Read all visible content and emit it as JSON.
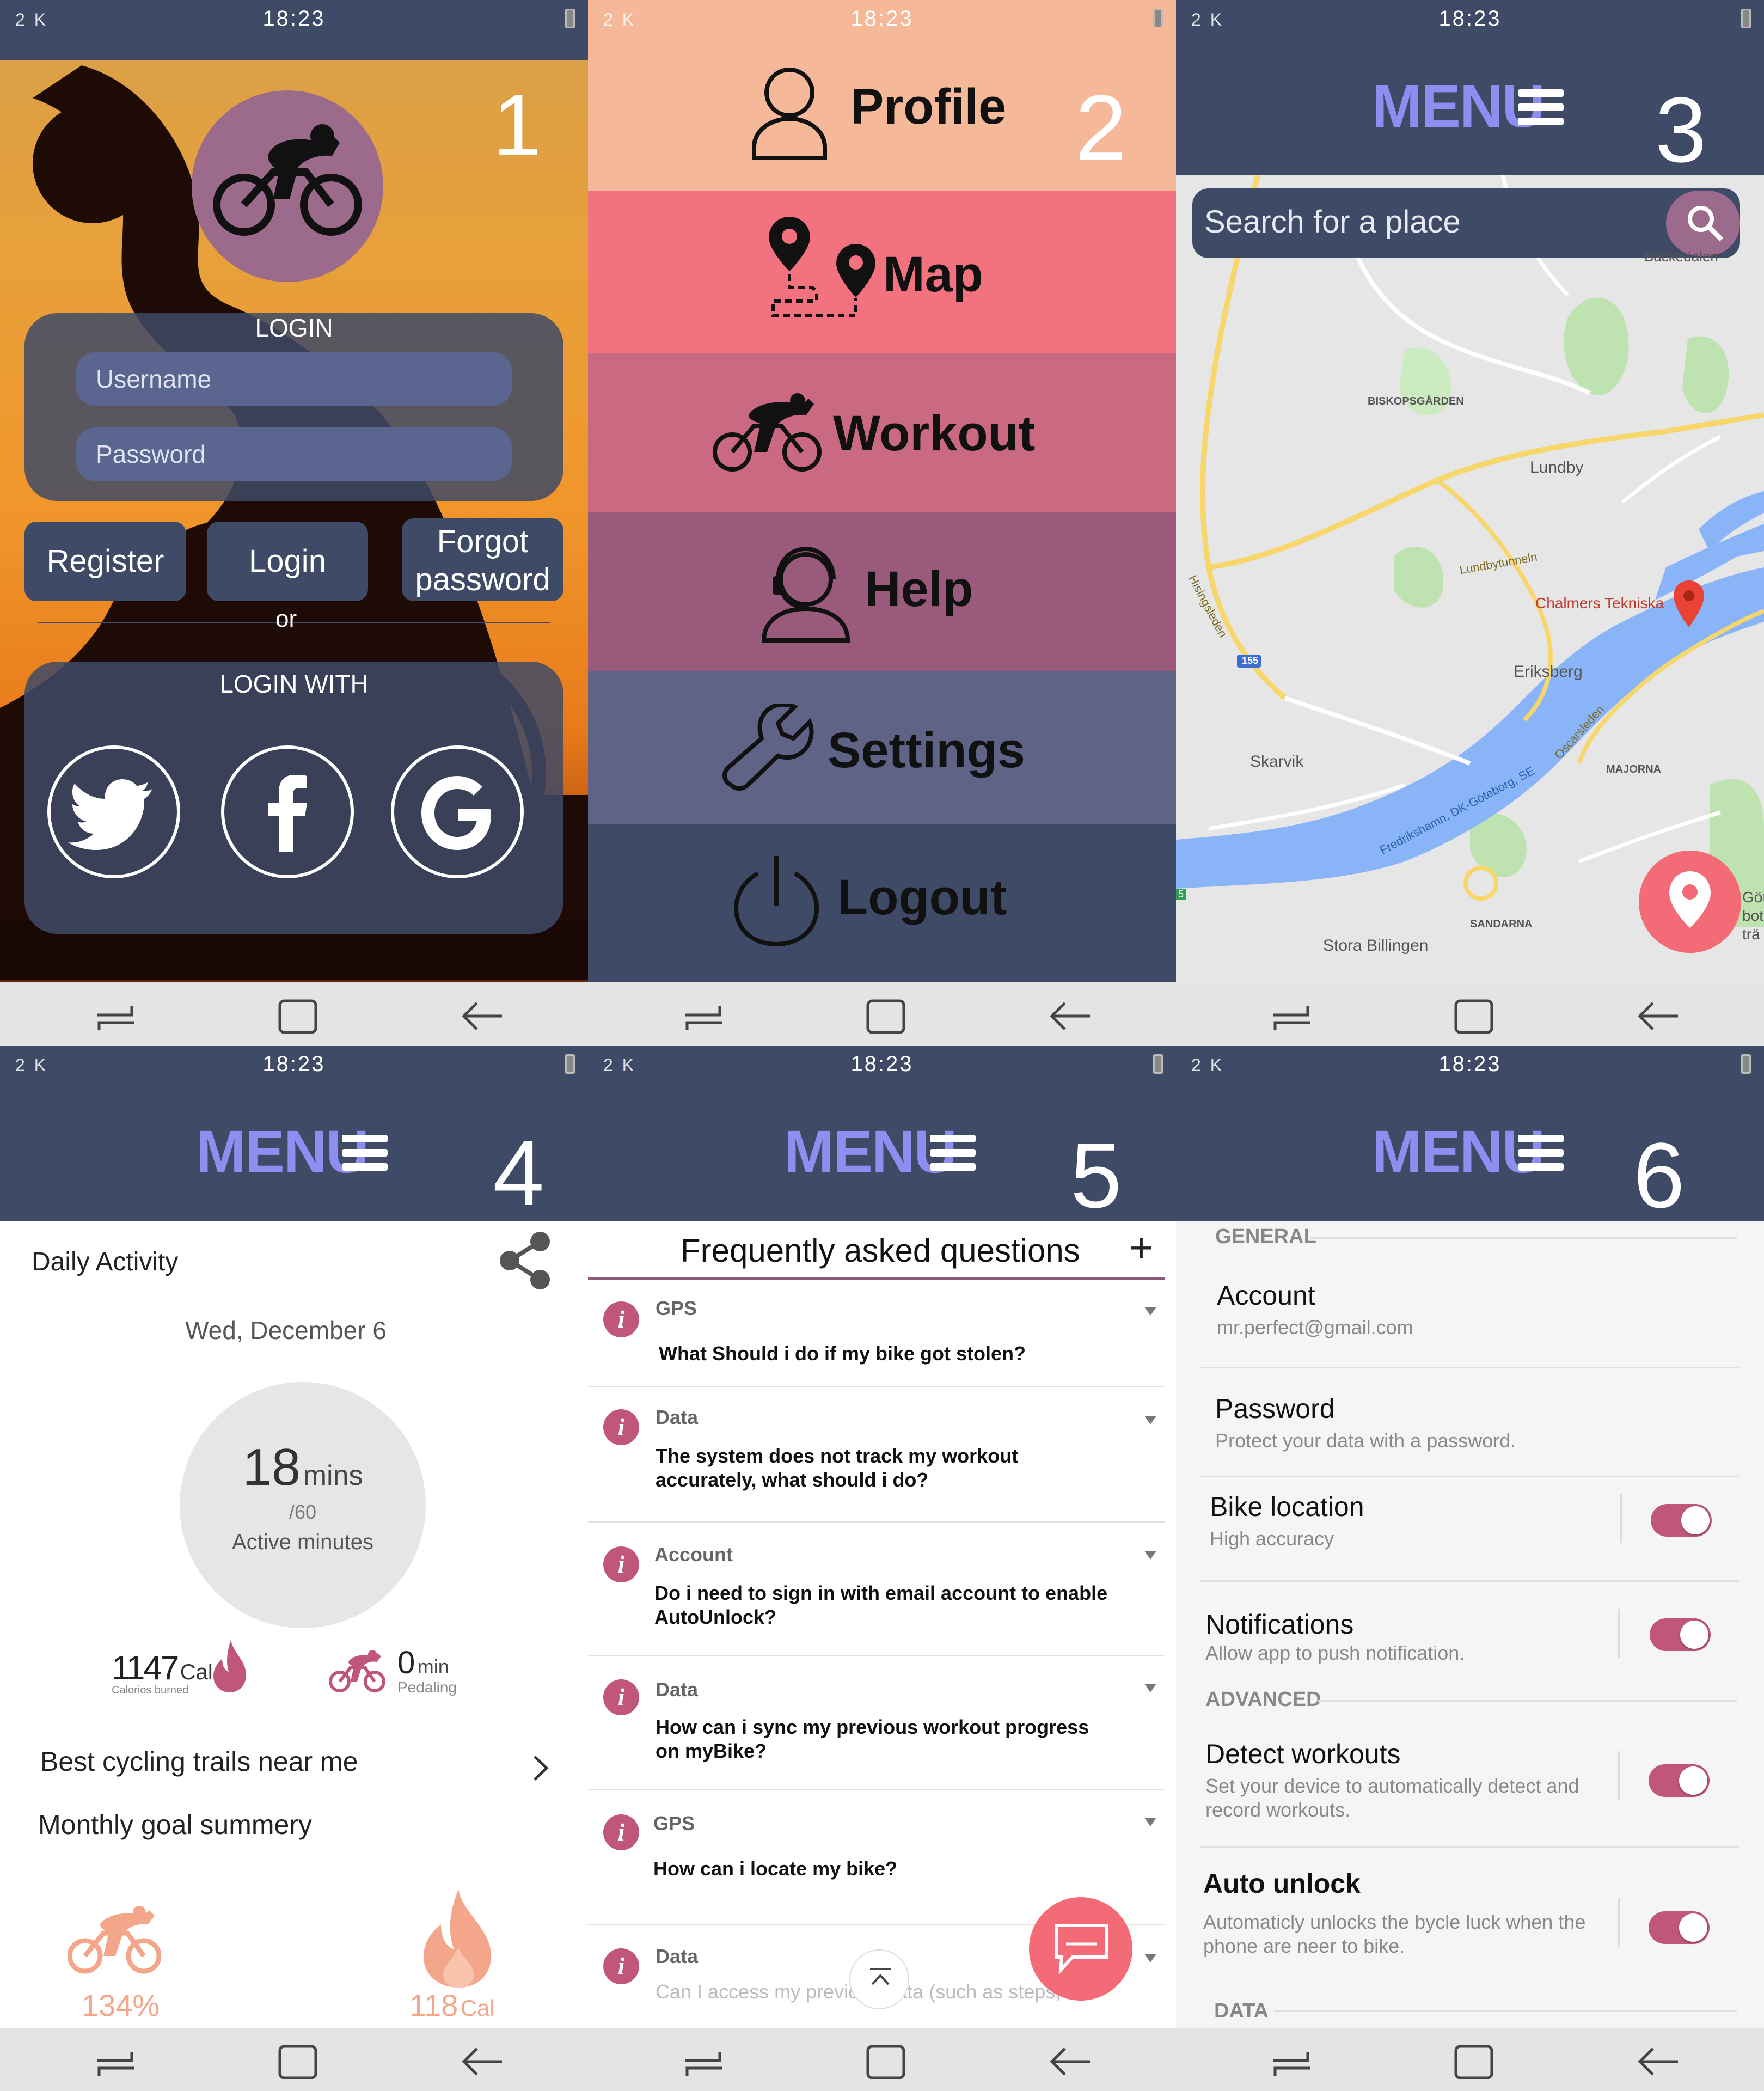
{
  "status": {
    "signal": "2 K",
    "time": "18:23"
  },
  "panels": {
    "p1": {
      "number": "1",
      "login_title": "LOGIN",
      "username_placeholder": "Username",
      "password_placeholder": "Password",
      "register": "Register",
      "login": "Login",
      "forgot_line1": "Forgot",
      "forgot_line2": "password",
      "or": "or",
      "login_with": "LOGIN WITH",
      "social": [
        "twitter-icon",
        "facebook-icon",
        "google-icon"
      ]
    },
    "p2": {
      "number": "2",
      "items": [
        {
          "label": "Profile",
          "icon": "profile-icon",
          "color": "#f5b898"
        },
        {
          "label": "Map",
          "icon": "map-pin-icon",
          "color": "#f2727f"
        },
        {
          "label": "Workout",
          "icon": "cyclist-icon",
          "color": "#c96a82"
        },
        {
          "label": "Help",
          "icon": "support-agent-icon",
          "color": "#9a5a7c"
        },
        {
          "label": "Settings",
          "icon": "wrench-icon",
          "color": "#5f6386"
        },
        {
          "label": "Logout",
          "icon": "power-icon",
          "color": "#3f4a66"
        }
      ]
    },
    "p3": {
      "number": "3",
      "menu": "MENU",
      "search_placeholder": "Search for a place",
      "map_labels": {
        "backedalen": "Backedalen",
        "biskopsgarden": "BISKOPSGÅRDEN",
        "lundby": "Lundby",
        "hisingsleden": "Hisingsleden",
        "lundbytunneln": "Lundbytunneln",
        "chalmers": "Chalmers Tekniska",
        "eriksberg": "Eriksberg",
        "route155": "155",
        "skarvik": "Skarvik",
        "majorna": "MAJORNA",
        "oscarsleden": "Oscarsleden",
        "fredrikshamn": "Fredrikshamn, DK-Göteborg, SE",
        "sandarna": "SANDARNA",
        "stora_billingen": "Stora Billingen",
        "edge_got": "Göt",
        "edge_bot": "bot",
        "edge_tra": "trä",
        "route_edge": "5"
      }
    },
    "p4": {
      "number": "4",
      "menu": "MENU",
      "daily_activity": "Daily Activity",
      "date": "Wed, December 6",
      "active_value": "18",
      "active_unit": "mins",
      "active_goal": "/60",
      "active_label": "Active minutes",
      "calories_value": "1147",
      "calories_unit": "Cal",
      "calories_label": "Calorios burned",
      "pedaling_value": "0",
      "pedaling_unit": "min",
      "pedaling_label": "Pedaling",
      "trails": "Best cycling trails near me",
      "monthly": "Monthly goal summery",
      "goal_percent": "134%",
      "goal_cal": "118",
      "goal_cal_unit": "Cal",
      "accent": "#f4a68a"
    },
    "p5": {
      "number": "5",
      "menu": "MENU",
      "title": "Frequently asked questions",
      "plus": "+",
      "faqs": [
        {
          "cat": "GPS",
          "q": "What Should i do if my bike got stolen?"
        },
        {
          "cat": "Data",
          "q": "The system does not track my workout accurately, what should i do?"
        },
        {
          "cat": "Account",
          "q": "Do i need to sign in with email account to enable AutoUnlock?"
        },
        {
          "cat": "Data",
          "q": "How can i sync my previous workout progress on myBike?"
        },
        {
          "cat": "GPS",
          "q": "How can i locate my bike?"
        },
        {
          "cat": "Data",
          "q": "Can I access my previous data (such as steps, ..."
        }
      ]
    },
    "p6": {
      "number": "6",
      "menu": "MENU",
      "general": "GENERAL",
      "account_t": "Account",
      "account_s": "mr.perfect@gmail.com",
      "password_t": "Password",
      "password_s": "Protect your data with a password.",
      "bike_t": "Bike location",
      "bike_s": "High accuracy",
      "notif_t": "Notifications",
      "notif_s": "Allow app to push notification.",
      "advanced": "ADVANCED",
      "detect_t": "Detect workouts",
      "detect_s": "Set your device to automatically detect and record workouts.",
      "auto_t": "Auto unlock",
      "auto_s": "Automaticly unlocks the bycle luck when the phone are neer to bike.",
      "data": "DATA",
      "toggles": [
        true,
        true,
        true,
        true
      ]
    }
  }
}
